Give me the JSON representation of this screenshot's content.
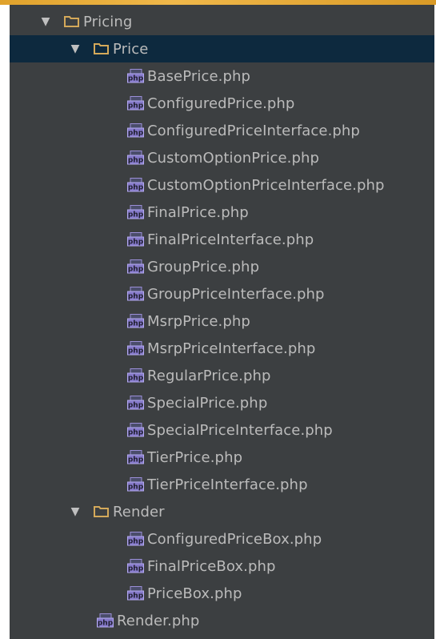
{
  "tree": {
    "pricing": {
      "label": "Pricing",
      "icon": "folder-icon",
      "expanded": true
    },
    "price_folder": {
      "label": "Price",
      "icon": "folder-icon",
      "expanded": true,
      "selected": true,
      "files": [
        "BasePrice.php",
        "ConfiguredPrice.php",
        "ConfiguredPriceInterface.php",
        "CustomOptionPrice.php",
        "CustomOptionPriceInterface.php",
        "FinalPrice.php",
        "FinalPriceInterface.php",
        "GroupPrice.php",
        "GroupPriceInterface.php",
        "MsrpPrice.php",
        "MsrpPriceInterface.php",
        "RegularPrice.php",
        "SpecialPrice.php",
        "SpecialPriceInterface.php",
        "TierPrice.php",
        "TierPriceInterface.php"
      ]
    },
    "render_folder": {
      "label": "Render",
      "icon": "folder-icon",
      "expanded": true,
      "files": [
        "ConfiguredPriceBox.php",
        "FinalPriceBox.php",
        "PriceBox.php"
      ]
    },
    "render_file": {
      "label": "Render.php",
      "icon": "php-file-icon"
    },
    "arrow_glyph": "▼"
  },
  "colors": {
    "panel_bg": "#3c3f41",
    "selected_bg": "#0d293e",
    "text": "#bbbbbb",
    "folder": "#d4a95a",
    "php_icon": "#9b8fd8",
    "accent": "#e0a22c"
  }
}
